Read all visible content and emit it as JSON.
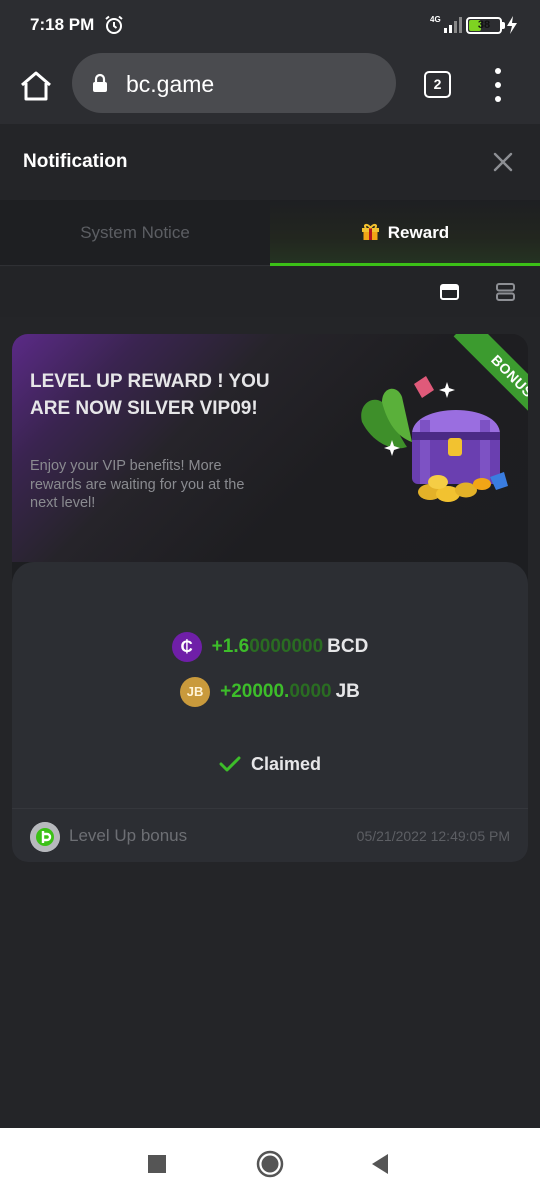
{
  "status_bar": {
    "time": "7:18 PM",
    "network": "4G",
    "battery": "38",
    "battery_level": 0.38
  },
  "browser": {
    "url": "bc.game",
    "tab_count": "2"
  },
  "notification": {
    "title": "Notification",
    "tabs": [
      {
        "label": "System Notice",
        "active": false
      },
      {
        "label": "Reward",
        "active": true
      }
    ]
  },
  "reward_card": {
    "badge": "BONUS",
    "title": "LEVEL UP REWARD ! YOU ARE NOW SILVER VIP09!",
    "description": "Enjoy your VIP benefits! More rewards are waiting for you at the next level!",
    "amounts": [
      {
        "coin_symbol": "₵",
        "bright": "+1.6",
        "dim": "0000000",
        "unit": "BCD"
      },
      {
        "coin_symbol": "JB",
        "bright": "+20000.",
        "dim": "0000",
        "unit": "JB"
      }
    ],
    "status": "Claimed",
    "footer_label": "Level Up bonus",
    "footer_date": "05/21/2022 12:49:05 PM"
  },
  "colors": {
    "accent_green": "#3bc117",
    "background": "#242528",
    "card_inner": "#2c2e33",
    "bcd_purple": "#6f1fa8",
    "jb_gold": "#c99a3c"
  }
}
